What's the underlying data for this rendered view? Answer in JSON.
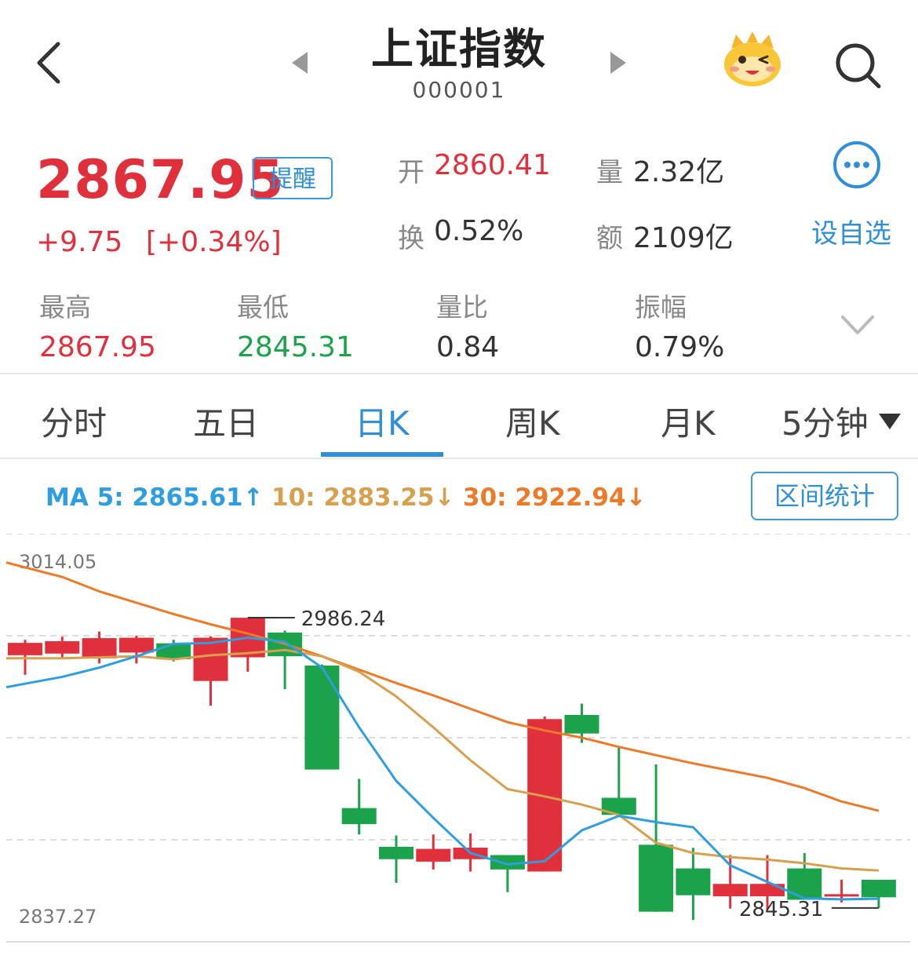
{
  "header": {
    "title": "上证指数",
    "code": "000001"
  },
  "quote": {
    "price": "2867.95",
    "alert_label": "提醒",
    "change": "+9.75",
    "change_pct": "[+0.34%]",
    "open_label": "开",
    "open_value": "2860.41",
    "volume_label": "量",
    "volume_value": "2.32亿",
    "turnover_label": "换",
    "turnover_value": "0.52%",
    "amount_label": "额",
    "amount_value": "2109亿",
    "watch_label": "设自选"
  },
  "stats": [
    {
      "label": "最高",
      "value": "2867.95",
      "color": "#e0303b"
    },
    {
      "label": "最低",
      "value": "2845.31",
      "color": "#1aa34a"
    },
    {
      "label": "量比",
      "value": "0.84",
      "color": "#333333"
    },
    {
      "label": "振幅",
      "value": "0.79%",
      "color": "#333333"
    }
  ],
  "tabs": [
    {
      "label": "分时",
      "active": false
    },
    {
      "label": "五日",
      "active": false
    },
    {
      "label": "日K",
      "active": true
    },
    {
      "label": "周K",
      "active": false
    },
    {
      "label": "月K",
      "active": false
    },
    {
      "label": "5分钟",
      "active": false
    }
  ],
  "ma": {
    "ma5": "MA 5: 2865.61↑",
    "ma10": "10: 2883.25↓",
    "ma30": "30: 2922.94↓",
    "ma5_color": "#2f9ee0",
    "ma10_color": "#d6a04e",
    "ma30_color": "#ec7a28"
  },
  "range_label": "区间统计",
  "chart_data": {
    "type": "candlestick",
    "axis_max_label": "3014.05",
    "axis_min_label": "2837.27",
    "ylim": [
      2837.27,
      3014.05
    ],
    "high_marker": "2986.24",
    "low_marker": "2845.31",
    "up_color": "#e0303b",
    "down_color": "#1aa34a",
    "candles": [
      {
        "o": 2968.0,
        "c": 2974.0,
        "h": 2975.5,
        "l": 2958.5
      },
      {
        "o": 2968.8,
        "c": 2974.8,
        "h": 2977.0,
        "l": 2966.0
      },
      {
        "o": 2966.5,
        "c": 2976.3,
        "h": 2979.5,
        "l": 2964.0
      },
      {
        "o": 2969.3,
        "c": 2976.5,
        "h": 2977.5,
        "l": 2964.0
      },
      {
        "o": 2973.8,
        "c": 2966.0,
        "h": 2975.5,
        "l": 2965.0
      },
      {
        "o": 2955.5,
        "c": 2976.5,
        "h": 2977.2,
        "l": 2943.5
      },
      {
        "o": 2967.0,
        "c": 2986.2,
        "h": 2986.2,
        "l": 2960.0
      },
      {
        "o": 2979.0,
        "c": 2967.5,
        "h": 2980.0,
        "l": 2951.5
      },
      {
        "o": 2963.0,
        "c": 2912.5,
        "h": 2963.5,
        "l": 2912.5
      },
      {
        "o": 2893.8,
        "c": 2886.0,
        "h": 2908.0,
        "l": 2881.0
      },
      {
        "o": 2875.0,
        "c": 2869.0,
        "h": 2880.5,
        "l": 2857.5
      },
      {
        "o": 2867.8,
        "c": 2874.0,
        "h": 2881.0,
        "l": 2864.0
      },
      {
        "o": 2869.0,
        "c": 2874.6,
        "h": 2881.5,
        "l": 2863.0
      },
      {
        "o": 2871.0,
        "c": 2864.0,
        "h": 2871.0,
        "l": 2853.0
      },
      {
        "o": 2863.0,
        "c": 2937.0,
        "h": 2938.3,
        "l": 2863.0
      },
      {
        "o": 2939.0,
        "c": 2930.0,
        "h": 2944.5,
        "l": 2925.5
      },
      {
        "o": 2898.8,
        "c": 2890.5,
        "h": 2923.5,
        "l": 2890.5
      },
      {
        "o": 2876.0,
        "c": 2843.5,
        "h": 2915.0,
        "l": 2843.5
      },
      {
        "o": 2864.5,
        "c": 2851.5,
        "h": 2874.5,
        "l": 2839.5
      },
      {
        "o": 2851.0,
        "c": 2857.0,
        "h": 2871.0,
        "l": 2845.0
      },
      {
        "o": 2851.0,
        "c": 2857.0,
        "h": 2871.0,
        "l": 2844.5
      },
      {
        "o": 2864.5,
        "c": 2849.3,
        "h": 2872.0,
        "l": 2849.3
      },
      {
        "o": 2852.0,
        "c": 2852.0,
        "h": 2859.0,
        "l": 2848.0
      },
      {
        "o": 2859.0,
        "c": 2850.5,
        "h": 2859.0,
        "l": 2845.3
      }
    ],
    "ma5_series": [
      2952.5,
      2957.5,
      2962.0,
      2967.5,
      2973.5,
      2974.0,
      2976.5,
      2974.5,
      2962.0,
      2933.0,
      2907.0,
      2889.0,
      2872.0,
      2866.5,
      2868.0,
      2883.0,
      2890.0,
      2887.0,
      2884.5,
      2866.0,
      2858.0,
      2850.0,
      2849.5,
      2849.8
    ],
    "ma10_series": [
      2966.5,
      2966.5,
      2967.0,
      2967.5,
      2966.0,
      2968.0,
      2969.0,
      2970.5,
      2967.5,
      2960.0,
      2948.0,
      2933.0,
      2917.0,
      2903.0,
      2899.5,
      2895.5,
      2890.5,
      2877.0,
      2872.0,
      2870.0,
      2868.8,
      2867.0,
      2864.5,
      2863.5
    ],
    "ma30_series": [
      3013.0,
      3006.0,
      2999.0,
      2993.5,
      2988.0,
      2983.0,
      2978.5,
      2973.5,
      2967.5,
      2961.0,
      2954.5,
      2948.5,
      2942.0,
      2935.5,
      2931.5,
      2928.0,
      2923.5,
      2919.5,
      2915.5,
      2912.0,
      2908.5,
      2903.5,
      2897.0,
      2892.5
    ]
  }
}
